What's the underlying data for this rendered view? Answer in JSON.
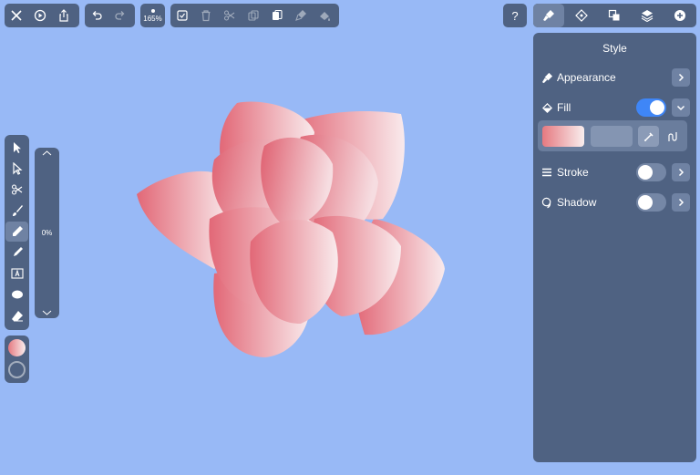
{
  "toolbar": {
    "zoom_label": "165%",
    "help_label": "?",
    "groups": {
      "file": [
        "close-icon",
        "play-icon",
        "share-icon"
      ],
      "history": [
        "undo-icon",
        "redo-icon"
      ],
      "edit": [
        "select-checkbox-icon",
        "trash-icon",
        "scissors-icon",
        "copy-icon",
        "paste-icon",
        "paint-picker-icon",
        "fill-bucket-icon"
      ]
    },
    "right_tabs": [
      "style-brush-icon",
      "node-diamond-icon",
      "arrange-icon",
      "layers-icon",
      "add-icon"
    ]
  },
  "inspector": {
    "title": "Style",
    "appearance_label": "Appearance",
    "fill_label": "Fill",
    "fill_enabled": true,
    "stroke_label": "Stroke",
    "stroke_enabled": false,
    "shadow_label": "Shadow",
    "shadow_enabled": false,
    "fill_gradient_colors": [
      "#e57980",
      "#f9eeee"
    ]
  },
  "left_tools": {
    "active": "pen-tool",
    "items": [
      "select-arrow-icon",
      "direct-select-icon",
      "scissors-icon",
      "brush-icon",
      "pen-icon",
      "pencil-icon",
      "text-icon",
      "ellipse-icon",
      "eraser-icon"
    ]
  },
  "slider": {
    "value_label": "0%"
  },
  "colors": {
    "accent": "#3f86f7",
    "panel": "#4f6282",
    "canvas_bg": "#98b9f6",
    "petal_dark": "#e26877",
    "petal_light": "#f9eaec"
  }
}
